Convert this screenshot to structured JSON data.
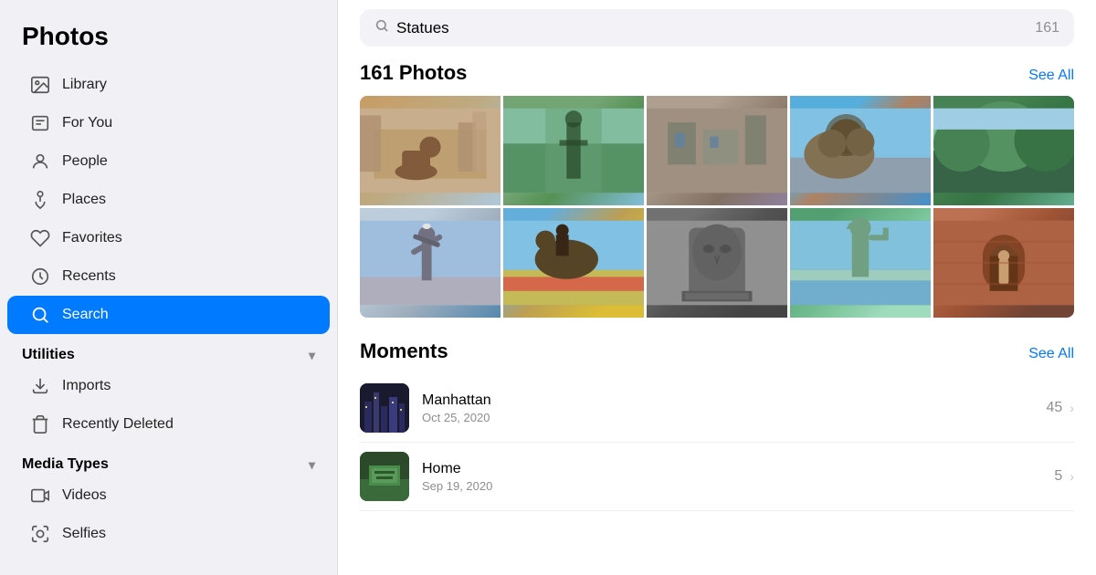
{
  "sidebar": {
    "title": "Photos",
    "nav_items": [
      {
        "id": "library",
        "label": "Library",
        "icon": "library"
      },
      {
        "id": "for-you",
        "label": "For You",
        "icon": "for-you"
      },
      {
        "id": "people",
        "label": "People",
        "icon": "people"
      },
      {
        "id": "places",
        "label": "Places",
        "icon": "places"
      },
      {
        "id": "favorites",
        "label": "Favorites",
        "icon": "favorites"
      },
      {
        "id": "recents",
        "label": "Recents",
        "icon": "recents"
      },
      {
        "id": "search",
        "label": "Search",
        "icon": "search",
        "active": true
      }
    ],
    "utilities_section": {
      "label": "Utilities",
      "items": [
        {
          "id": "imports",
          "label": "Imports",
          "icon": "imports"
        },
        {
          "id": "recently-deleted",
          "label": "Recently Deleted",
          "icon": "recently-deleted"
        }
      ]
    },
    "media_types_section": {
      "label": "Media Types",
      "items": [
        {
          "id": "videos",
          "label": "Videos",
          "icon": "videos"
        },
        {
          "id": "selfies",
          "label": "Selfies",
          "icon": "selfies"
        }
      ]
    }
  },
  "main": {
    "search": {
      "query": "Statues",
      "result_count": "161",
      "placeholder": "Search"
    },
    "photos_section": {
      "title": "161 Photos",
      "see_all_label": "See All"
    },
    "moments_section": {
      "title": "Moments",
      "see_all_label": "See All",
      "items": [
        {
          "id": "manhattan",
          "name": "Manhattan",
          "date": "Oct 25, 2020",
          "count": "45"
        },
        {
          "id": "home",
          "name": "Home",
          "date": "Sep 19, 2020",
          "count": "5"
        }
      ]
    }
  }
}
